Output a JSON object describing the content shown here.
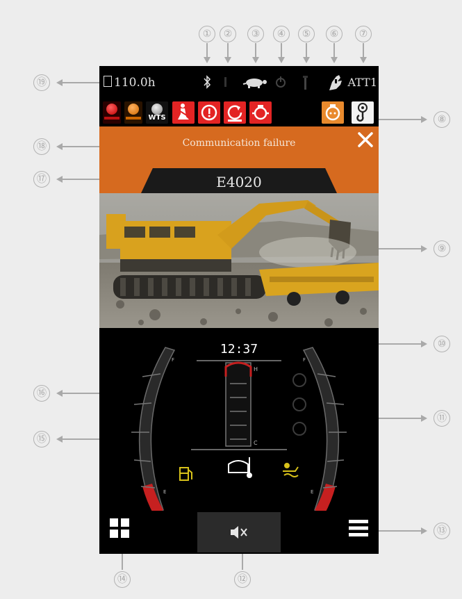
{
  "status": {
    "hours": "110.0h",
    "attachment": "ATT1"
  },
  "alert": {
    "message": "Communication failure",
    "code": "E4020"
  },
  "clock": "12:37",
  "gauge_labels": {
    "hot": "H",
    "cold": "C",
    "full": "F",
    "empty": "E"
  },
  "warning_labels": {
    "wts": "WTS"
  },
  "callouts": [
    "①",
    "②",
    "③",
    "④",
    "⑤",
    "⑥",
    "⑦",
    "⑧",
    "⑨",
    "⑩",
    "⑪",
    "⑫",
    "⑬",
    "⑭",
    "⑮",
    "⑯",
    "⑰",
    "⑱",
    "⑲"
  ],
  "colors": {
    "alert_orange": "#d66a1f",
    "warn_red": "#e32424",
    "fuel_yellow": "#d8c21a"
  }
}
